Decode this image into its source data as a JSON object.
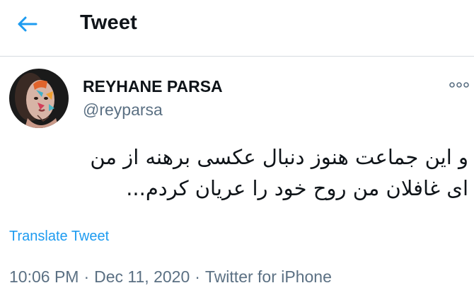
{
  "header": {
    "back_icon": "arrow-left-icon",
    "title": "Tweet"
  },
  "author": {
    "display_name": "REYHANE PARSA",
    "handle": "@reyparsa",
    "avatar": "profile-photo"
  },
  "more_icon": "more-options-icon",
  "tweet": {
    "lines": [
      "و این جماعت هنوز دنبال عکسی برهنه از من",
      "ای غافلان من روح خود را عریان کردم..."
    ]
  },
  "translate_label": "Translate Tweet",
  "meta": {
    "time": "10:06 PM",
    "separator": "·",
    "date": "Dec 11, 2020",
    "source": "Twitter for iPhone"
  },
  "colors": {
    "accent": "#1d9bf0",
    "muted": "#5b7083",
    "text": "#0f1419",
    "divider": "#d6dbe0"
  }
}
